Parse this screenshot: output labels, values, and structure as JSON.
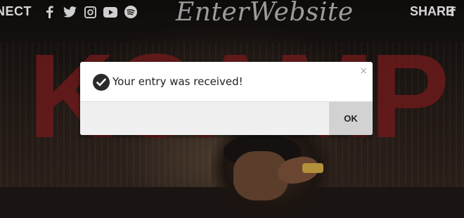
{
  "header": {
    "connect_label": "NECT",
    "logo_text": "EnterWebsite",
    "share_label": "SHARE",
    "social_icons": [
      "facebook-icon",
      "twitter-icon",
      "instagram-icon",
      "youtube-icon",
      "spotify-icon"
    ],
    "share_icons": [
      "facebook-icon"
    ]
  },
  "background": {
    "big_text": "KCAMP"
  },
  "dialog": {
    "message": "Your entry was received!",
    "close_glyph": "×",
    "ok_label": "OK",
    "icon": "check-circle-icon"
  },
  "colors": {
    "accent_red": "#6b1a1a",
    "dialog_bg": "#ffffff",
    "button_bg": "#d2d2d2"
  }
}
